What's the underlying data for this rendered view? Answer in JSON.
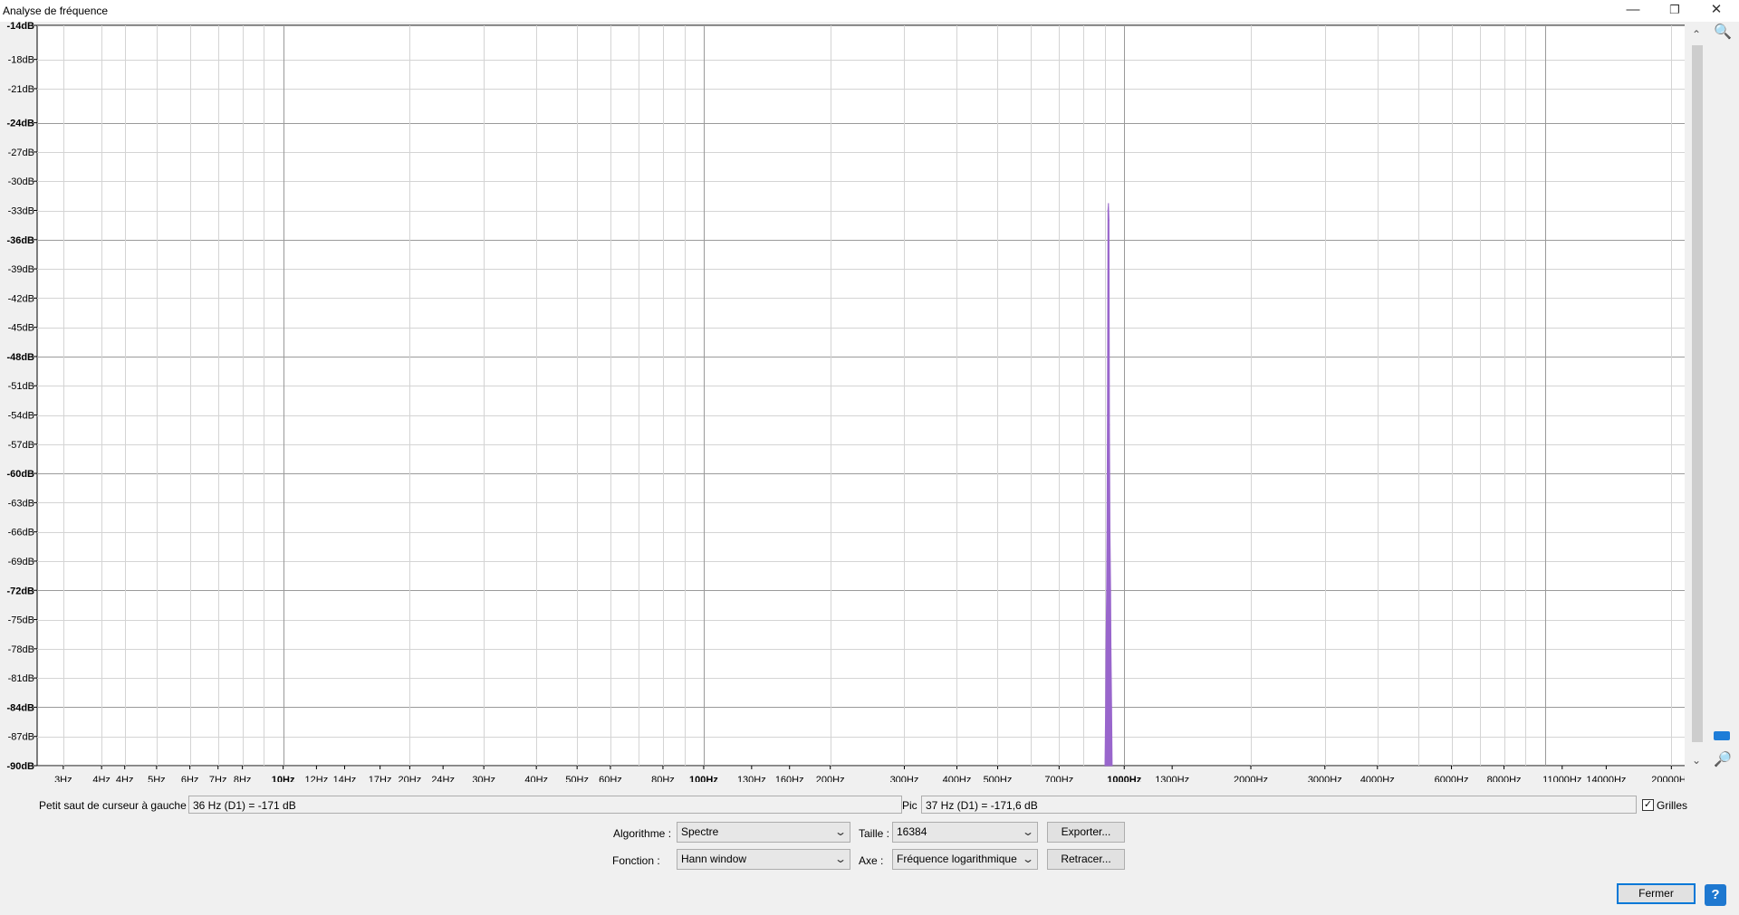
{
  "window": {
    "title": "Analyse de fréquence"
  },
  "chart_data": {
    "type": "area",
    "title": "",
    "xlabel": "",
    "ylabel": "",
    "x_scale": "log",
    "xlim": [
      2.6,
      22050
    ],
    "ylim": [
      -90,
      -14
    ],
    "grid": true,
    "color": "#9966CC",
    "y_ticks": [
      "-14dB",
      "-18dB",
      "-21dB",
      "-24dB",
      "-27dB",
      "-30dB",
      "-33dB",
      "-36dB",
      "-39dB",
      "-42dB",
      "-45dB",
      "-48dB",
      "-51dB",
      "-54dB",
      "-57dB",
      "-60dB",
      "-63dB",
      "-66dB",
      "-69dB",
      "-72dB",
      "-75dB",
      "-78dB",
      "-81dB",
      "-84dB",
      "-87dB",
      "-90dB"
    ],
    "y_tick_values": [
      -14,
      -17.5,
      -20.5,
      -24,
      -27,
      -30,
      -33,
      -36,
      -39,
      -42,
      -45,
      -48,
      -51,
      -54,
      -57,
      -60,
      -63,
      -66,
      -69,
      -72,
      -75,
      -78,
      -81,
      -84,
      -87,
      -90
    ],
    "y_major": [
      "-14dB",
      "-24dB",
      "-36dB",
      "-48dB",
      "-60dB",
      "-72dB",
      "-84dB",
      "-90dB"
    ],
    "x_ticks": [
      "3Hz",
      "4Hz",
      "4Hz",
      "5Hz",
      "6Hz",
      "7Hz",
      "8Hz",
      "10Hz",
      "12Hz",
      "14Hz",
      "17Hz",
      "20Hz",
      "24Hz",
      "30Hz",
      "40Hz",
      "50Hz",
      "60Hz",
      "80Hz",
      "100Hz",
      "130Hz",
      "160Hz",
      "200Hz",
      "300Hz",
      "400Hz",
      "500Hz",
      "700Hz",
      "1000Hz",
      "1300Hz",
      "2000Hz",
      "3000Hz",
      "4000Hz",
      "6000Hz",
      "8000Hz",
      "11000Hz",
      "14000Hz",
      "20000Hz"
    ],
    "x_tick_values": [
      3,
      3.7,
      4.2,
      5,
      6,
      7,
      8,
      10,
      12,
      14,
      17,
      20,
      24,
      30,
      40,
      50,
      60,
      80,
      100,
      130,
      160,
      200,
      300,
      400,
      500,
      700,
      1000,
      1300,
      2000,
      3000,
      4000,
      6000,
      8000,
      11000,
      14000,
      20000
    ],
    "x_major": [
      "10Hz",
      "100Hz",
      "1000Hz"
    ],
    "x_grid": [
      3,
      3.7,
      4.2,
      5,
      6,
      7,
      8,
      9,
      10,
      20,
      30,
      40,
      50,
      60,
      70,
      80,
      90,
      100,
      200,
      300,
      400,
      500,
      600,
      700,
      800,
      900,
      1000,
      2000,
      3000,
      4000,
      5000,
      6000,
      7000,
      8000,
      9000,
      10000,
      20000
    ],
    "series": [
      {
        "x": [
          900,
          903,
          905,
          908,
          910,
          912,
          915,
          917,
          920,
          922,
          925,
          928,
          930,
          933,
          936
        ],
        "y": [
          -90,
          -84,
          -78,
          -72,
          -66,
          -54,
          -33,
          -32.3,
          -34,
          -55,
          -66,
          -72,
          -78,
          -84,
          -90
        ]
      }
    ]
  },
  "cursor": {
    "label": "Petit saut de curseur à gauche :",
    "value": "36 Hz (D1) = -171 dB"
  },
  "peak": {
    "label": "Pic :",
    "value": "37 Hz (D1) = -171,6 dB"
  },
  "grid_toggle": {
    "label": "Grilles",
    "checked": true
  },
  "controls": {
    "algorithm_label": "Algorithme :",
    "algorithm_value": "Spectre",
    "size_label": "Taille :",
    "size_value": "16384",
    "function_label": "Fonction :",
    "function_value": "Hann window",
    "axis_label": "Axe :",
    "axis_value": "Fréquence logarithmique",
    "export_button": "Exporter...",
    "redraw_button": "Retracer..."
  },
  "close_button": "Fermer",
  "help_icon_glyph": "?",
  "icons": [
    "zoom-in-icon",
    "zoom-out-icon",
    "scroll-up-icon",
    "scroll-down-icon",
    "help-icon",
    "maximize-icon",
    "close-icon"
  ]
}
